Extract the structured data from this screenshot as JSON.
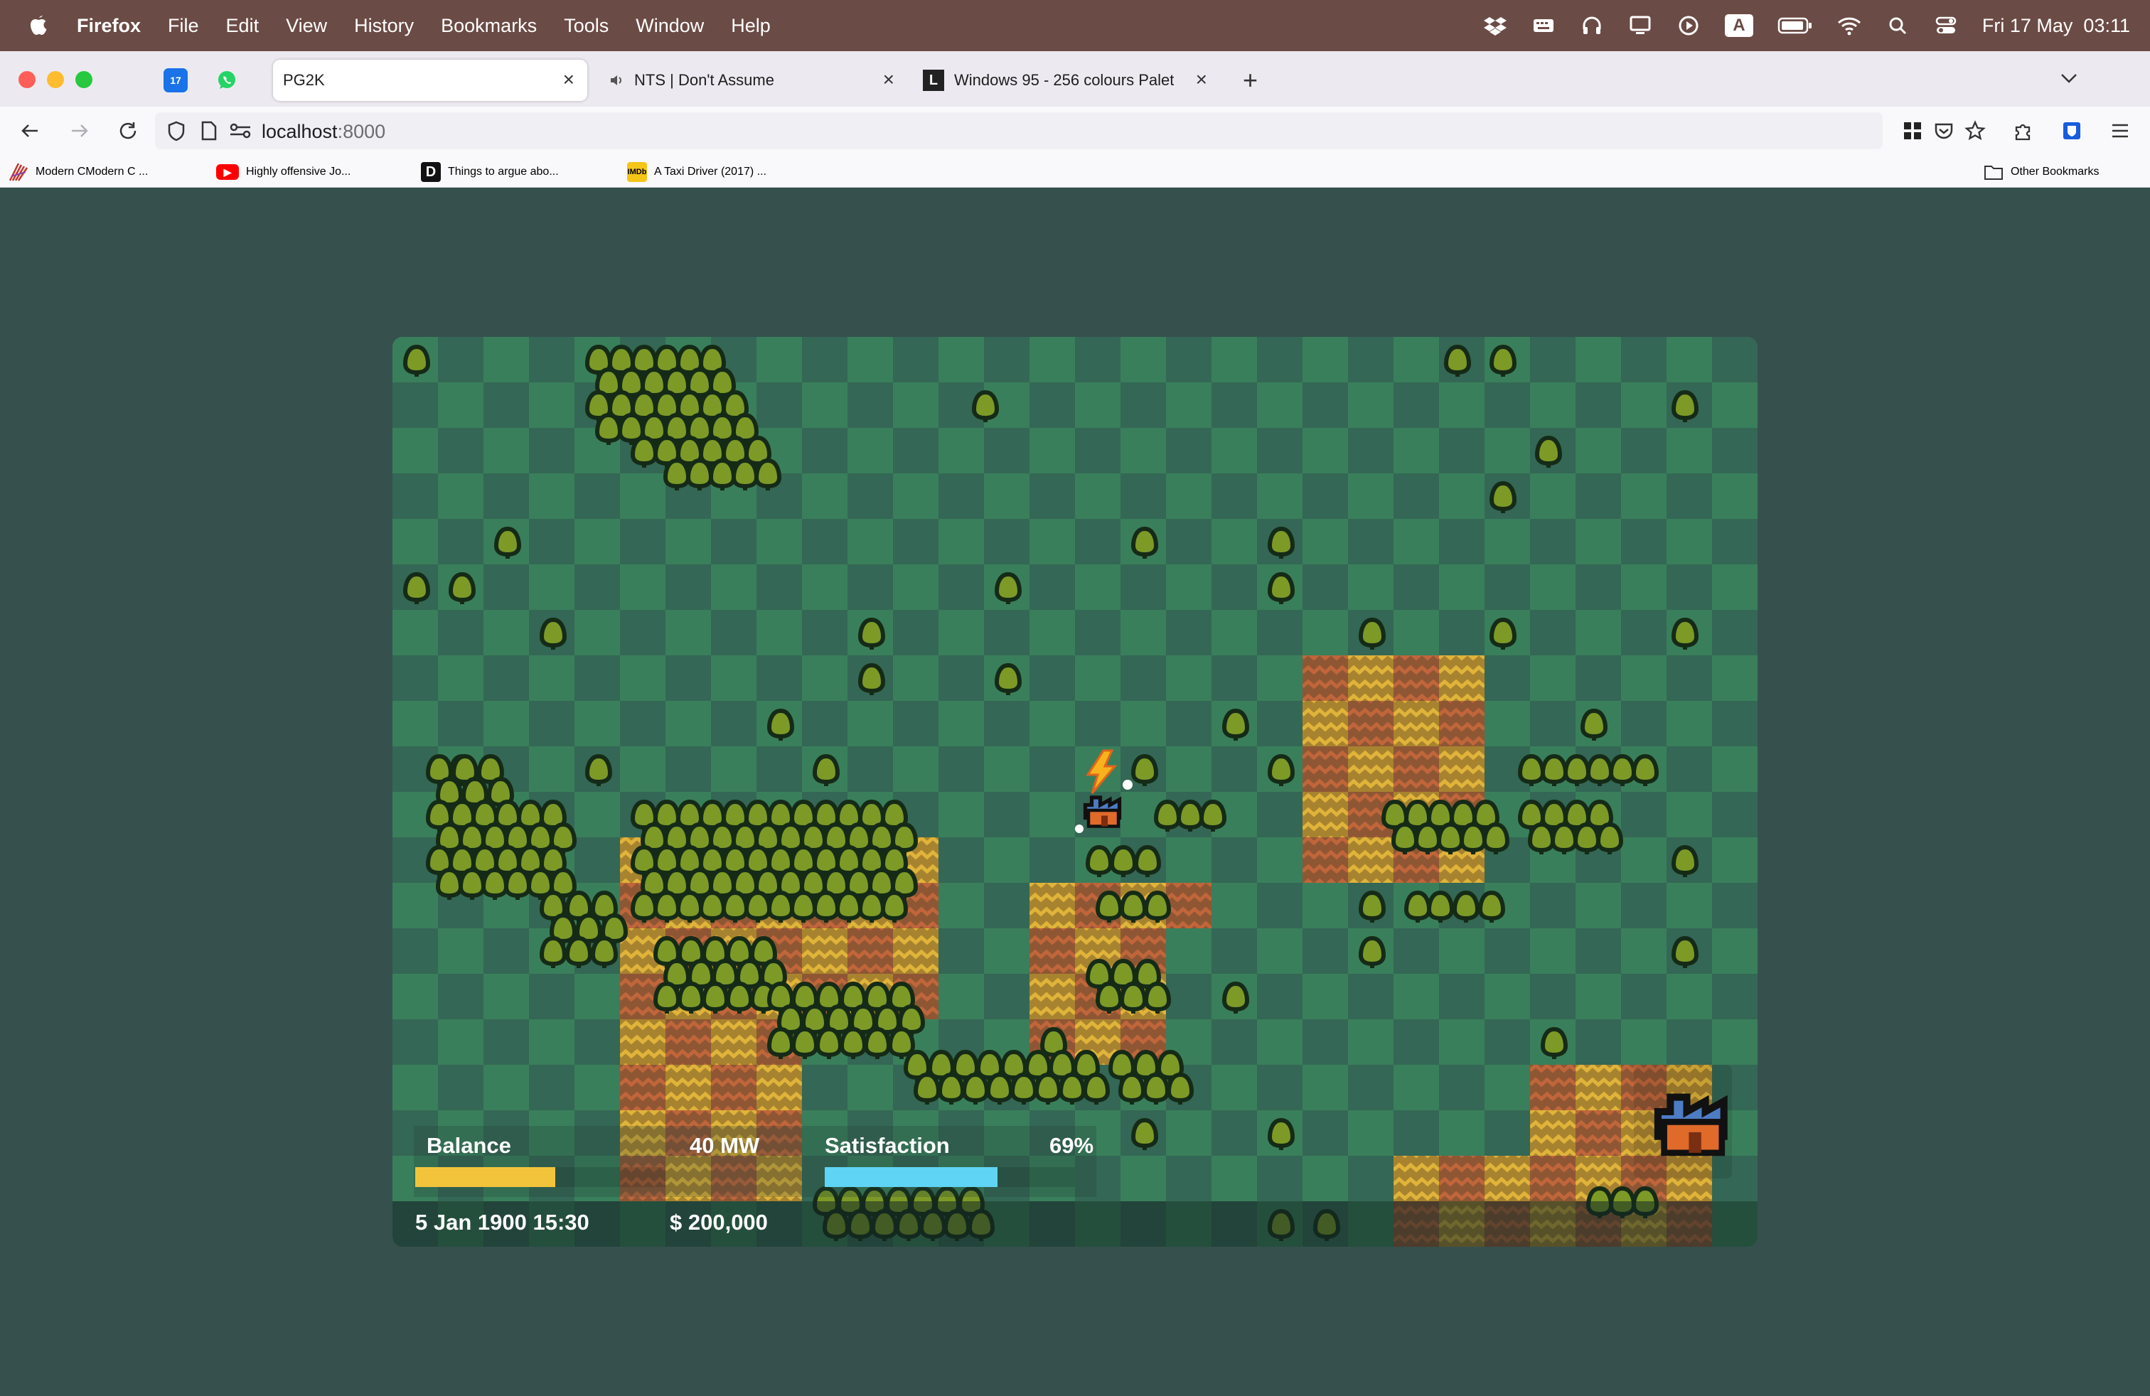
{
  "menubar": {
    "app_name": "Firefox",
    "items": [
      "File",
      "Edit",
      "View",
      "History",
      "Bookmarks",
      "Tools",
      "Window",
      "Help"
    ],
    "clock": "Fri 17 May  03:11",
    "status_icons": [
      "dropbox-icon",
      "keyboard-icon",
      "headphones-icon",
      "display-icon",
      "play-icon",
      "input-source-icon",
      "battery-icon",
      "wifi-icon",
      "spotlight-icon",
      "control-center-icon"
    ],
    "input_source_letter": "A"
  },
  "tabs": {
    "pinned": [
      {
        "name": "calendar-pinned-tab",
        "badge": "17"
      },
      {
        "name": "whatsapp-pinned-tab"
      }
    ],
    "items": [
      {
        "label": "PG2K",
        "active": true
      },
      {
        "label": "NTS | Don't Assume",
        "audio": true
      },
      {
        "label": "Windows 95 - 256 colours Palet"
      }
    ]
  },
  "navbar": {
    "url_host": "localhost",
    "url_port": ":8000"
  },
  "bookmarks": [
    {
      "label": "Modern CModern C ..."
    },
    {
      "label": "Highly offensive Jo..."
    },
    {
      "label": "Things to argue abo..."
    },
    {
      "label": "A Taxi Driver (2017) ..."
    }
  ],
  "other_bookmarks": "Other Bookmarks",
  "game": {
    "power_label": "40 MW",
    "balance_label": "Balance",
    "satisfaction_label": "Satisfaction",
    "satisfaction_value": "69%",
    "satisfaction_level": 0.69,
    "power_level": 0.56,
    "date": "5 Jan 1900 15:30",
    "money": "$ 200,000",
    "colors": {
      "tile_light": "#3a7f5b",
      "tile_dark": "#346755",
      "tree_fill": "#7d9a27",
      "tree_outline": "#152b17",
      "balance_bar": "#f2c43b",
      "satisfaction_bar": "#5fd4f5",
      "factory_orange": "#e06a2a",
      "factory_blue": "#4d7cc5"
    }
  }
}
